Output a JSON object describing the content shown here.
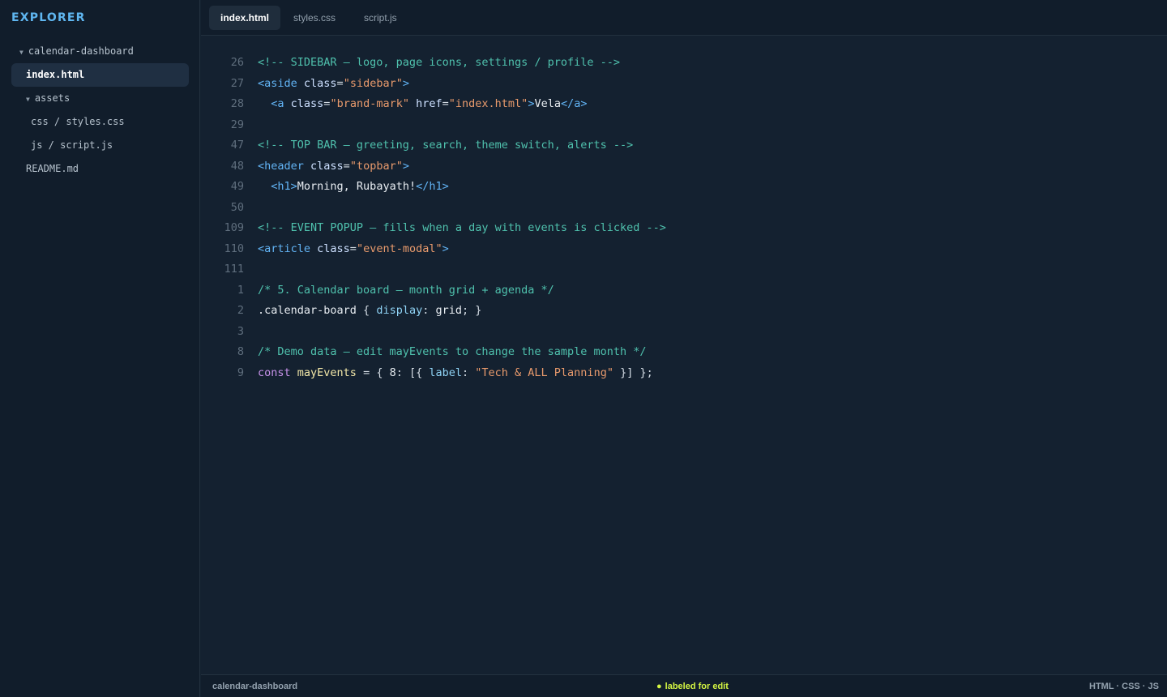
{
  "explorer": {
    "title": "EXPLORER",
    "tree": [
      {
        "label": "calendar-dashboard",
        "type": "folder"
      },
      {
        "label": "index.html",
        "type": "file",
        "active": true
      },
      {
        "label": "assets",
        "type": "folder"
      },
      {
        "label": "css / styles.css",
        "type": "file"
      },
      {
        "label": "js / script.js",
        "type": "file"
      },
      {
        "label": "README.md",
        "type": "file"
      }
    ]
  },
  "tabs": [
    {
      "label": "index.html",
      "active": true
    },
    {
      "label": "styles.css",
      "active": false
    },
    {
      "label": "script.js",
      "active": false
    }
  ],
  "editor": {
    "lines": [
      {
        "n": "26",
        "tokens": [
          [
            "c",
            "<!-- SIDEBAR — logo, page icons, settings / profile -->"
          ]
        ]
      },
      {
        "n": "27",
        "tokens": [
          [
            "t",
            "<aside "
          ],
          [
            "a",
            "class"
          ],
          [
            "p",
            "="
          ],
          [
            "s",
            "\"sidebar\""
          ],
          [
            "t",
            ">"
          ]
        ]
      },
      {
        "n": "28",
        "tokens": [
          [
            "x",
            "  "
          ],
          [
            "t",
            "<a "
          ],
          [
            "a",
            "class"
          ],
          [
            "p",
            "="
          ],
          [
            "s",
            "\"brand-mark\""
          ],
          [
            "x",
            " "
          ],
          [
            "a",
            "href"
          ],
          [
            "p",
            "="
          ],
          [
            "s",
            "\"index.html\""
          ],
          [
            "t",
            ">"
          ],
          [
            "x",
            "Vela"
          ],
          [
            "t",
            "</a>"
          ]
        ]
      },
      {
        "n": "29",
        "tokens": []
      },
      {
        "n": "47",
        "tokens": [
          [
            "c",
            "<!-- TOP BAR — greeting, search, theme switch, alerts -->"
          ]
        ]
      },
      {
        "n": "48",
        "tokens": [
          [
            "t",
            "<header "
          ],
          [
            "a",
            "class"
          ],
          [
            "p",
            "="
          ],
          [
            "s",
            "\"topbar\""
          ],
          [
            "t",
            ">"
          ]
        ]
      },
      {
        "n": "49",
        "tokens": [
          [
            "x",
            "  "
          ],
          [
            "t",
            "<h1>"
          ],
          [
            "x",
            "Morning, Rubayath!"
          ],
          [
            "t",
            "</h1>"
          ]
        ]
      },
      {
        "n": "50",
        "tokens": []
      },
      {
        "n": "109",
        "tokens": [
          [
            "c",
            "<!-- EVENT POPUP — fills when a day with events is clicked -->"
          ]
        ]
      },
      {
        "n": "110",
        "tokens": [
          [
            "t",
            "<article "
          ],
          [
            "a",
            "class"
          ],
          [
            "p",
            "="
          ],
          [
            "s",
            "\"event-modal\""
          ],
          [
            "t",
            ">"
          ]
        ]
      },
      {
        "n": "111",
        "tokens": []
      },
      {
        "n": "1",
        "tokens": [
          [
            "c",
            "/* 5. Calendar board — month grid + agenda */"
          ]
        ]
      },
      {
        "n": "2",
        "tokens": [
          [
            "x",
            ".calendar-board "
          ],
          [
            "p",
            "{ "
          ],
          [
            "r",
            "display"
          ],
          [
            "p",
            ": "
          ],
          [
            "x",
            "grid"
          ],
          [
            "p",
            "; }"
          ]
        ]
      },
      {
        "n": "3",
        "tokens": []
      },
      {
        "n": "8",
        "tokens": [
          [
            "c",
            "/* Demo data — edit mayEvents to change the sample month */"
          ]
        ]
      },
      {
        "n": "9",
        "tokens": [
          [
            "k",
            "const "
          ],
          [
            "v",
            "mayEvents"
          ],
          [
            "p",
            " = { "
          ],
          [
            "x",
            "8"
          ],
          [
            "p",
            ": [{ "
          ],
          [
            "r",
            "label"
          ],
          [
            "p",
            ": "
          ],
          [
            "s",
            "\"Tech & ALL Planning\""
          ],
          [
            "p",
            " }] };"
          ]
        ]
      }
    ]
  },
  "status": {
    "project": "calendar-dashboard",
    "dot": "●",
    "state": "labeled for edit",
    "langs": "HTML · CSS · JS"
  }
}
